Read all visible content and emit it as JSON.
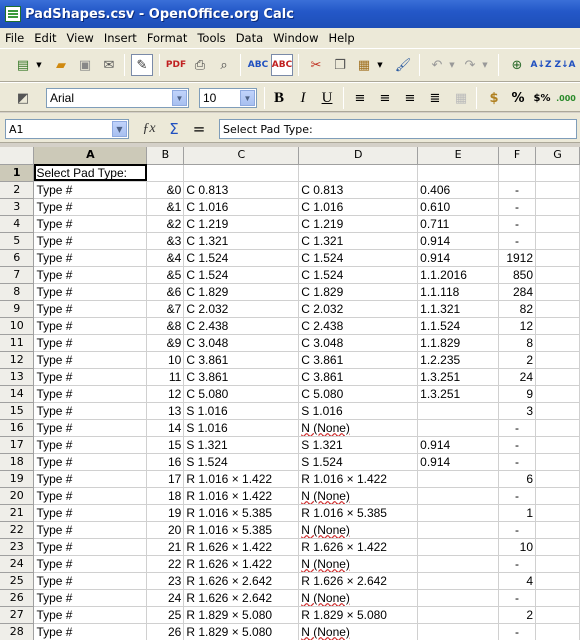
{
  "window": {
    "title": "PadShapes.csv - OpenOffice.org Calc"
  },
  "menu": [
    "File",
    "Edit",
    "View",
    "Insert",
    "Format",
    "Tools",
    "Data",
    "Window",
    "Help"
  ],
  "format": {
    "font_name": "Arial",
    "font_size": "10"
  },
  "formula": {
    "cell_ref": "A1",
    "content": "Select Pad Type:"
  },
  "columns": [
    "A",
    "B",
    "C",
    "D",
    "E",
    "F",
    "G"
  ],
  "rows": [
    {
      "n": "1",
      "a": "Select Pad Type:",
      "b": "",
      "c": "",
      "d": "",
      "e": "",
      "f": ""
    },
    {
      "n": "2",
      "a": "Type #",
      "b": "&0",
      "c": "C 0.813",
      "d": "C 0.813",
      "e": "0.406",
      "f": "-"
    },
    {
      "n": "3",
      "a": "Type #",
      "b": "&1",
      "c": "C 1.016",
      "d": "C 1.016",
      "e": "0.610",
      "f": "-"
    },
    {
      "n": "4",
      "a": "Type #",
      "b": "&2",
      "c": "C 1.219",
      "d": "C 1.219",
      "e": "0.711",
      "f": "-"
    },
    {
      "n": "5",
      "a": "Type #",
      "b": "&3",
      "c": "C 1.321",
      "d": "C 1.321",
      "e": "0.914",
      "f": "-"
    },
    {
      "n": "6",
      "a": "Type #",
      "b": "&4",
      "c": "C 1.524",
      "d": "C 1.524",
      "e": "0.914",
      "f": "1912"
    },
    {
      "n": "7",
      "a": "Type #",
      "b": "&5",
      "c": "C 1.524",
      "d": "C 1.524",
      "e": "1.1.2016",
      "f": "850"
    },
    {
      "n": "8",
      "a": "Type #",
      "b": "&6",
      "c": "C 1.829",
      "d": "C 1.829",
      "e": "1.1.118",
      "f": "284"
    },
    {
      "n": "9",
      "a": "Type #",
      "b": "&7",
      "c": "C 2.032",
      "d": "C 2.032",
      "e": "1.1.321",
      "f": "82"
    },
    {
      "n": "10",
      "a": "Type #",
      "b": "&8",
      "c": "C 2.438",
      "d": "C 2.438",
      "e": "1.1.524",
      "f": "12"
    },
    {
      "n": "11",
      "a": "Type #",
      "b": "&9",
      "c": "C 3.048",
      "d": "C 3.048",
      "e": "1.1.829",
      "f": "8"
    },
    {
      "n": "12",
      "a": "Type #",
      "b": "10",
      "c": "C 3.861",
      "d": "C 3.861",
      "e": "1.2.235",
      "f": "2"
    },
    {
      "n": "13",
      "a": "Type #",
      "b": "11",
      "c": "C 3.861",
      "d": "C 3.861",
      "e": "1.3.251",
      "f": "24"
    },
    {
      "n": "14",
      "a": "Type #",
      "b": "12",
      "c": "C 5.080",
      "d": "C 5.080",
      "e": "1.3.251",
      "f": "9"
    },
    {
      "n": "15",
      "a": "Type #",
      "b": "13",
      "c": "S 1.016",
      "d": "S 1.016",
      "e": "",
      "f": "3"
    },
    {
      "n": "16",
      "a": "Type #",
      "b": "14",
      "c": "S 1.016",
      "d": "N (None)",
      "e": "",
      "f": "-"
    },
    {
      "n": "17",
      "a": "Type #",
      "b": "15",
      "c": "S 1.321",
      "d": "S 1.321",
      "e": "0.914",
      "f": "-"
    },
    {
      "n": "18",
      "a": "Type #",
      "b": "16",
      "c": "S 1.524",
      "d": "S 1.524",
      "e": "0.914",
      "f": "-"
    },
    {
      "n": "19",
      "a": "Type #",
      "b": "17",
      "c": "R 1.016 × 1.422",
      "d": "R 1.016 × 1.422",
      "e": "",
      "f": "6"
    },
    {
      "n": "20",
      "a": "Type #",
      "b": "18",
      "c": "R 1.016 × 1.422",
      "d": "N (None)",
      "e": "",
      "f": "-"
    },
    {
      "n": "21",
      "a": "Type #",
      "b": "19",
      "c": "R 1.016 × 5.385",
      "d": "R 1.016 × 5.385",
      "e": "",
      "f": "1"
    },
    {
      "n": "22",
      "a": "Type #",
      "b": "20",
      "c": "R 1.016 × 5.385",
      "d": "N (None)",
      "e": "",
      "f": "-"
    },
    {
      "n": "23",
      "a": "Type #",
      "b": "21",
      "c": "R 1.626 × 1.422",
      "d": "R 1.626 × 1.422",
      "e": "",
      "f": "10"
    },
    {
      "n": "24",
      "a": "Type #",
      "b": "22",
      "c": "R 1.626 × 1.422",
      "d": "N (None)",
      "e": "",
      "f": "-"
    },
    {
      "n": "25",
      "a": "Type #",
      "b": "23",
      "c": "R 1.626 × 2.642",
      "d": "R 1.626 × 2.642",
      "e": "",
      "f": "4"
    },
    {
      "n": "26",
      "a": "Type #",
      "b": "24",
      "c": "R 1.626 × 2.642",
      "d": "N (None)",
      "e": "",
      "f": "-"
    },
    {
      "n": "27",
      "a": "Type #",
      "b": "25",
      "c": "R 1.829 × 5.080",
      "d": "R 1.829 × 5.080",
      "e": "",
      "f": "2"
    },
    {
      "n": "28",
      "a": "Type #",
      "b": "26",
      "c": "R 1.829 × 5.080",
      "d": "N (None)",
      "e": "",
      "f": "-"
    }
  ]
}
